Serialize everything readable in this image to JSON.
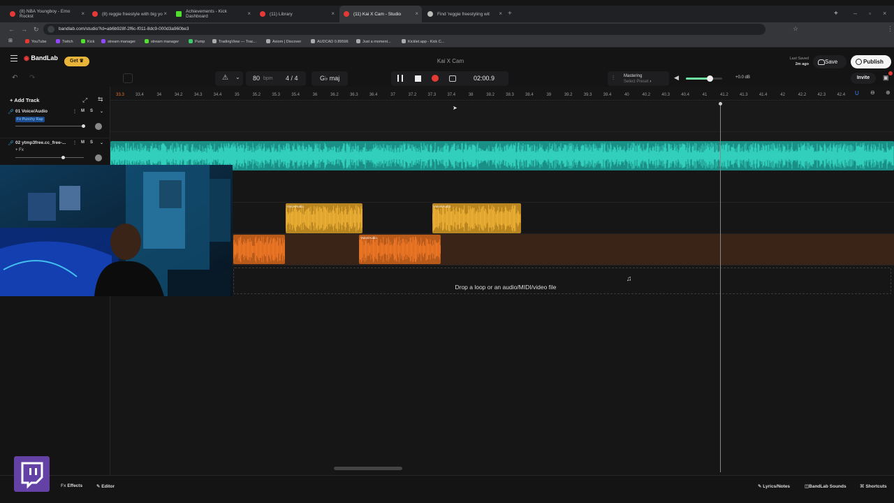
{
  "browser": {
    "tabs": [
      {
        "label": "(8) NBA Youngboy - Emo Rockst",
        "fav": "#e53935"
      },
      {
        "label": "(8) reggie freestyle with big yo",
        "fav": "#e53935"
      },
      {
        "label": "Achievements - Kick Dashboard",
        "fav": "#52e02e"
      },
      {
        "label": "(11) Library",
        "fav": "#e53935"
      },
      {
        "label": "(11) Kai X Cam - Studio",
        "fav": "#e53935",
        "active": true
      },
      {
        "label": "Find 'reggie freestyling wit",
        "fav": "#bbbbbb"
      }
    ],
    "url": "bandlab.com/studio?id=ab6b928f-2f6c-f011-8dc9-000d3a960be3",
    "bookmarks": [
      {
        "label": "YouTube",
        "color": "#e53935"
      },
      {
        "label": "Twitch",
        "color": "#9146ff"
      },
      {
        "label": "Kick",
        "color": "#52e02e"
      },
      {
        "label": "stream manager",
        "color": "#9146ff"
      },
      {
        "label": "stream manager",
        "color": "#52e02e"
      },
      {
        "label": "Pump",
        "color": "#3ec96b"
      },
      {
        "label": "TradingView — Trac...",
        "color": "#aaaaaa"
      },
      {
        "label": "Axiom | Discover",
        "color": "#aaaaaa"
      },
      {
        "label": "AUDCAD 0.89596",
        "color": "#aaaaaa"
      },
      {
        "label": "Just a moment...",
        "color": "#aaaaaa"
      },
      {
        "label": "Kicklet.app - Kick C...",
        "color": "#aaaaaa"
      }
    ]
  },
  "app": {
    "logo": "BandLab",
    "get_label": "Get",
    "project_title": "Kai X Cam",
    "last_saved_label": "Last Saved",
    "last_saved_value": "2m ago",
    "save_label": "Save",
    "publish_label": "Publish",
    "invite_label": "Invite"
  },
  "transport": {
    "bpm_value": "80",
    "bpm_label": "bpm",
    "time_signature": "4 / 4",
    "key": "G♭ maj",
    "time": "02:00.9",
    "mastering_label": "Mastering",
    "mastering_preset": "Select Preset",
    "volume_db": "+0.0 dB",
    "volume_level": 0.65
  },
  "tracks": [
    {
      "name": "01  Voice/Audio",
      "fx": "Fx Punchy Rap"
    },
    {
      "name": "02  ytmp3free.cc_free-...",
      "fx": "+ Fx"
    }
  ],
  "add_track_label": "Add Track",
  "ruler_ticks": [
    "33.3",
    "33.4",
    "34",
    "34.2",
    "34.3",
    "34.4",
    "35",
    "35.2",
    "35.3",
    "35.4",
    "36",
    "36.2",
    "36.3",
    "36.4",
    "37",
    "37.2",
    "37.3",
    "37.4",
    "38",
    "38.2",
    "38.3",
    "38.4",
    "39",
    "39.2",
    "39.3",
    "39.4",
    "40",
    "40.2",
    "40.3",
    "40.4",
    "41",
    "41.2",
    "41.3",
    "41.4",
    "42",
    "42.2",
    "42.3",
    "42.4"
  ],
  "clips": [
    {
      "label": "Voice/Audio",
      "color": "#e3a52a"
    },
    {
      "label": "Voice/Audio",
      "color": "#e3a52a"
    },
    {
      "label": "Voice/Audio",
      "color": "#e8752a"
    }
  ],
  "drop_text": "Drop a loop or an audio/MIDI/video file",
  "footer": {
    "effects": "Effects",
    "editor": "Editor",
    "lyrics": "Lyrics/Notes",
    "sounds": "BandLab Sounds",
    "shortcuts": "Shortcuts"
  }
}
